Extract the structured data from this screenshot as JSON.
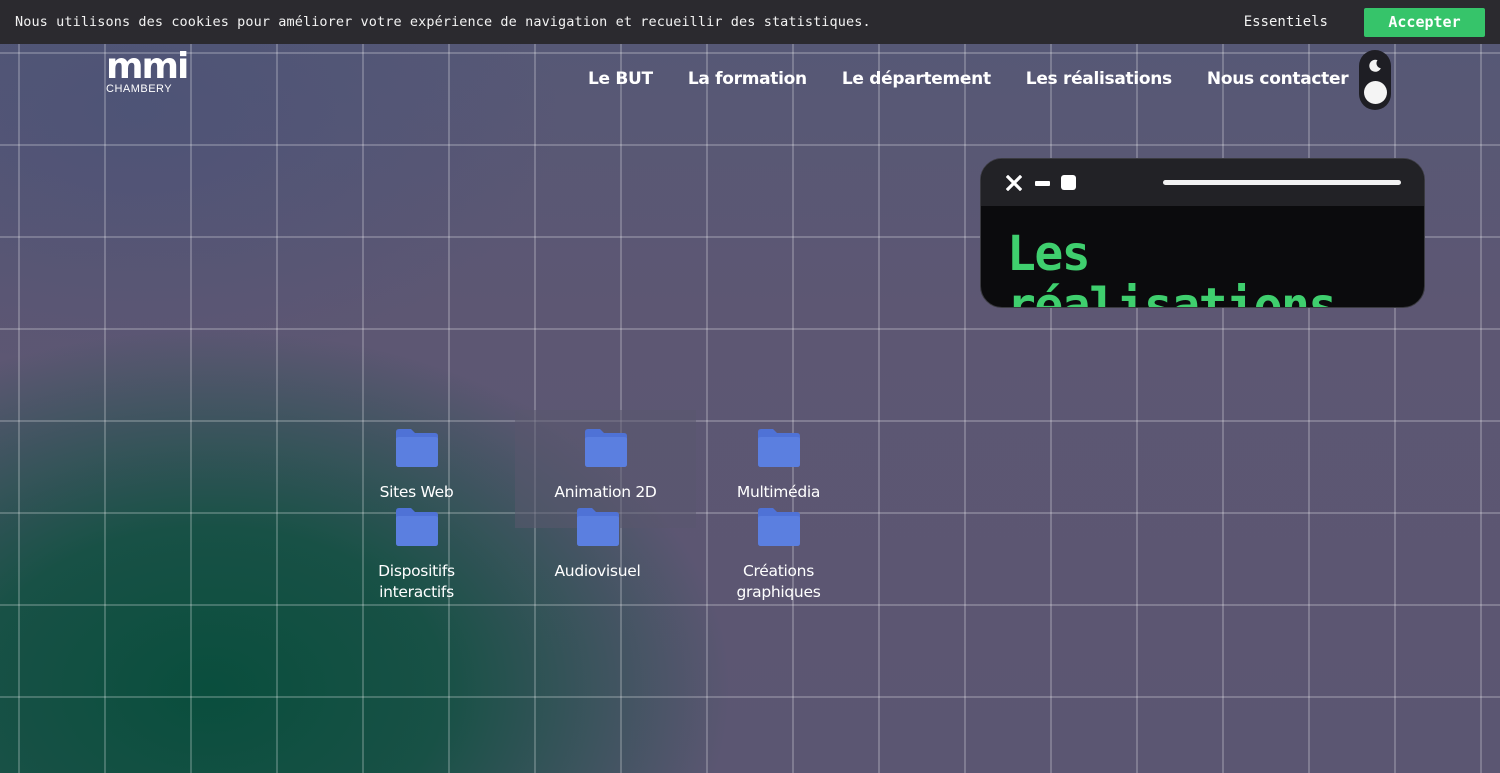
{
  "cookie_bar": {
    "message": "Nous utilisons des cookies pour améliorer votre expérience de navigation et recueillir des statistiques.",
    "essentials_label": "Essentiels",
    "accept_label": "Accepter"
  },
  "header": {
    "logo_mark": "mmi",
    "logo_sub": "CHAMBERY",
    "nav": [
      {
        "label": "Le BUT"
      },
      {
        "label": "La formation"
      },
      {
        "label": "Le département"
      },
      {
        "label": "Les réalisations"
      },
      {
        "label": "Nous contacter"
      }
    ],
    "theme_toggle_icon": "moon-icon"
  },
  "terminal": {
    "title": "Les réalisations",
    "controls": [
      "close-icon",
      "minimize-icon",
      "maximize-icon"
    ]
  },
  "folders": [
    {
      "label": "Sites Web",
      "selected": false
    },
    {
      "label": "Animation 2D",
      "selected": true
    },
    {
      "label": "Multimédia",
      "selected": false
    },
    {
      "label": "Dispositifs interactifs",
      "selected": false
    },
    {
      "label": "Audiovisuel",
      "selected": false
    },
    {
      "label": "Créations graphiques",
      "selected": false
    }
  ],
  "colors": {
    "accent_green": "#36c46a",
    "terminal_text": "#3fcf6e",
    "folder_blue": "#5b7fe0",
    "cookie_bar_bg": "#2b2a2f"
  }
}
